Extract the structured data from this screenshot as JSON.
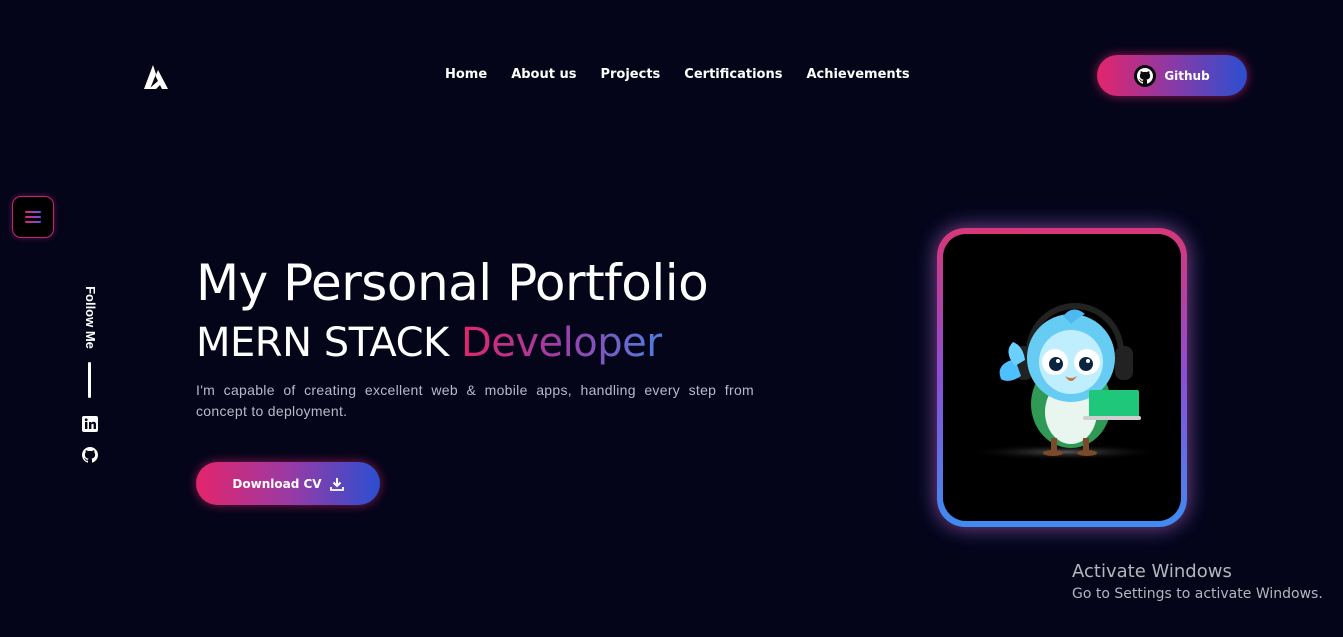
{
  "nav": {
    "items": [
      {
        "label": "Home"
      },
      {
        "label": "About us"
      },
      {
        "label": "Projects"
      },
      {
        "label": "Certifications"
      },
      {
        "label": "Achievements"
      }
    ],
    "github_label": "Github"
  },
  "sidebar": {
    "follow_label": "Follow Me",
    "social_icons": [
      "linkedin-icon",
      "github-icon"
    ]
  },
  "hero": {
    "title": "My Personal Portfolio",
    "subtitle_prefix": "MERN STACK ",
    "subtitle_highlight": "Developer",
    "description": "I'm capable of creating excellent web & mobile apps, handling every step from concept to deployment.",
    "cv_label": "Download CV"
  },
  "windows_watermark": {
    "line1": "Activate Windows",
    "line2": "Go to Settings to activate Windows."
  },
  "colors": {
    "background": "#05051a",
    "accent_pink": "#e3256b",
    "accent_blue": "#2b4fd1",
    "text_muted": "#b9b9c6"
  }
}
